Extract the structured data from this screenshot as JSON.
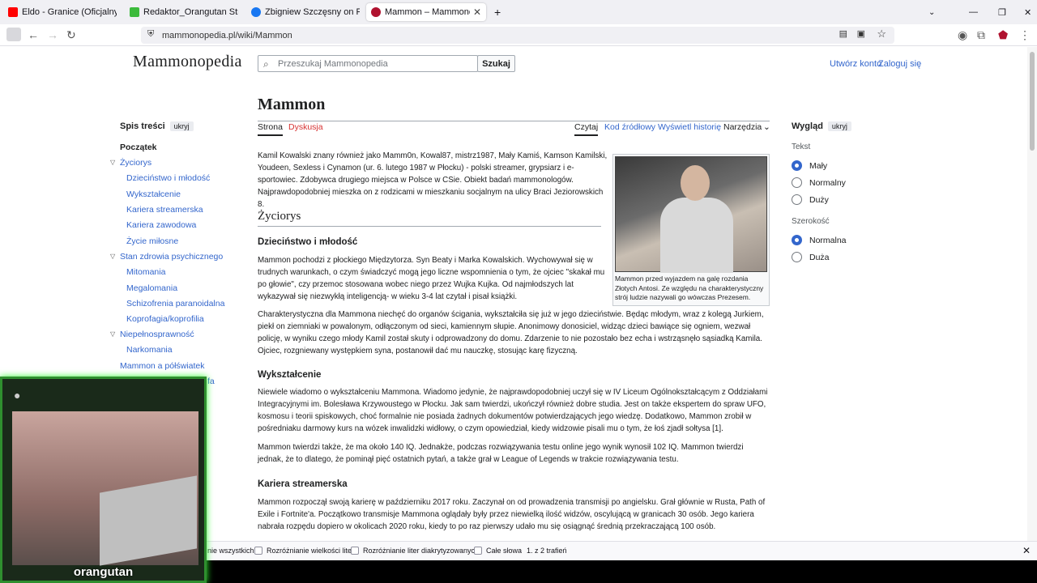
{
  "browser": {
    "tabs": [
      {
        "title": "Eldo - Granice (Oficjalny Teledys",
        "color": "#ff0000"
      },
      {
        "title": "Redaktor_Orangutan Stream - V",
        "color": "#3cba3c"
      },
      {
        "title": "Zbigniew Szczęsny on Reels | Fa",
        "color": "#1877f2"
      },
      {
        "title": "Mammon – Mammonopedia",
        "color": "#b0122f"
      }
    ],
    "url": "mammonopedia.pl/wiki/Mammon",
    "new_tab_icon": "+"
  },
  "site": {
    "logo": "Mammonopedia",
    "search_placeholder": "Przeszukaj Mammonopedia",
    "search_button": "Szukaj",
    "create_account": "Utwórz konto",
    "login": "Zaloguj się"
  },
  "toc": {
    "title": "Spis treści",
    "hide": "ukryj",
    "items": [
      "Początek",
      "Życiorys",
      "Dzieciństwo i młodość",
      "Wykształcenie",
      "Kariera streamerska",
      "Kariera zawodowa",
      "Życie miłosne",
      "Stan zdrowia psychicznego",
      "Mitomania",
      "Megalomania",
      "Schizofrenia paranoidalna",
      "Koprofagia/koprofilia",
      "Niepełnosprawność",
      "Narkomania",
      "Mammon a półświatek"
    ],
    "partial": "fa"
  },
  "article": {
    "title": "Mammon",
    "tab_page": "Strona",
    "tab_talk": "Dyskusja",
    "tab_read": "Czytaj",
    "tab_source": "Kod źródłowy",
    "tab_history": "Wyświetl historię",
    "tab_tools": "Narzędzia",
    "intro": "Kamil Kowalski znany również jako Mamm0n, Kowal87, mistrz1987, Mały Kamiś, Kamson Kamilski, Youdeen, Sexless i Cynamon (ur. 6. lutego 1987 w Płocku) - polski streamer, grypsiarz i e-sportowiec. Zdobywca drugiego miejsca w Polsce w CSie. Obiekt badań mammonologów. Najprawdopodobniej mieszka on z rodzicami w mieszkaniu socjalnym na ulicy Braci Jeziorowskich 8.",
    "h_zyciorys": "Życiorys",
    "h_dziecinstwo": "Dzieciństwo i młodość",
    "p_dz1": "Mammon pochodzi z płockiego Międzytorza. Syn Beaty i Marka Kowalskich. Wychowywał się w trudnych warunkach, o czym świadczyć mogą jego liczne wspomnienia o tym, że ojciec \"skakał mu po głowie\", czy przemoc stosowana wobec niego przez Wujka Kujka. Od najmłodszych lat wykazywał się niezwykłą inteligencją- w wieku 3-4 lat czytał i pisał książki.",
    "p_dz2": "Charakterystyczna dla Mammona niechęć do organów ścigania, wykształciła się już w jego dzieciństwie. Będąc młodym, wraz z kolegą Jurkiem, piekł on ziemniaki w powalonym, odłączonym od sieci, kamiennym słupie. Anonimowy donosiciel, widząc dzieci bawiące się ogniem, wezwał policję, w wyniku czego młody Kamil został skuty i odprowadzony do domu. Zdarzenie to nie pozostało bez echa i wstrząsnęło sąsiadką Kamila. Ojciec, rozgniewany występkiem syna, postanowił dać mu nauczkę, stosując karę fizyczną.",
    "h_wyksz": "Wykształcenie",
    "p_w1": "Niewiele wiadomo o wykształceniu Mammona. Wiadomo jedynie, że najprawdopodobniej uczył się w IV Liceum Ogólnokształcącym z Oddziałami Integracyjnymi im. Bolesława Krzywoustego w Płocku. Jak sam twierdzi, ukończył również dobre studia. Jest on także ekspertem do spraw UFO, kosmosu i teorii spiskowych, choć formalnie nie posiada żadnych dokumentów potwierdzających jego wiedzę. Dodatkowo, Mammon zrobił w pośredniaku darmowy kurs na wózek inwalidzki widłowy, o czym opowiedział, kiedy widzowie pisali mu o tym, że łoś zjadł sołtysa [1].",
    "p_w2": "Mammon twierdzi także, że ma około 140 IQ. Jednakże, podczas rozwiązywania testu online jego wynik wynosił 102 IQ. Mammon twierdzi jednak, że to dlatego, że pominął pięć ostatnich pytań, a także grał w League of Legends w trakcie rozwiązywania testu.",
    "h_kariera": "Kariera streamerska",
    "p_k1": "Mammon rozpoczął swoją karierę w październiku 2017 roku. Zaczynał on od prowadzenia transmisji po angielsku. Grał głównie w Rusta, Path of Exile i Fortnite'a. Początkowo transmisje Mammona oglądały były przez niewielką ilość widzów, oscylującą w granicach 30 osób. Jego kariera nabrała rozpędu dopiero w okolicach 2020 roku, kiedy to po raz pierwszy udało mu się osiągnąć średnią przekraczającą 100 osób.",
    "caption": "Mammon przed wyjazdem na galę rozdania Złotych Antosi. Ze względu na charakterystyczny strój ludzie nazywali go wówczas Prezesem."
  },
  "appearance": {
    "title": "Wygląd",
    "hide": "ukryj",
    "text_label": "Tekst",
    "text_options": [
      "Mały",
      "Normalny",
      "Duży"
    ],
    "width_label": "Szerokość",
    "width_options": [
      "Normalna",
      "Duża"
    ]
  },
  "findbar": {
    "highlight_all": "nie wszystkich",
    "match_case": "Rozróżnianie wielkości liter",
    "match_diacritics": "Rozróżnianie liter diakrytyzowanych",
    "whole_words": "Całe słowa",
    "result": "1. z 2 trafień"
  },
  "overlay": {
    "label": "orangutan"
  }
}
